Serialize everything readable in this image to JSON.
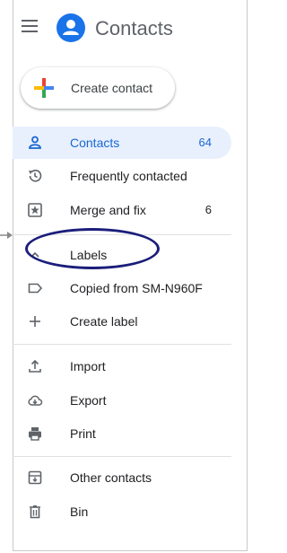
{
  "app": {
    "title": "Contacts"
  },
  "create_button": {
    "label": "Create contact"
  },
  "nav": {
    "contacts": {
      "label": "Contacts",
      "count": "64"
    },
    "frequent": {
      "label": "Frequently contacted"
    },
    "merge": {
      "label": "Merge and fix",
      "count": "6"
    }
  },
  "labels_section": {
    "header": "Labels",
    "items": [
      {
        "label": "Copied from SM-N960F"
      }
    ],
    "create_label": "Create label"
  },
  "tools": {
    "import": "Import",
    "export": "Export",
    "print": "Print"
  },
  "bottom": {
    "other_contacts": "Other contacts",
    "bin": "Bin"
  },
  "colors": {
    "accent": "#1a73e8",
    "active_bg": "#e8f0fe",
    "annotation": "#1b1e7a"
  }
}
